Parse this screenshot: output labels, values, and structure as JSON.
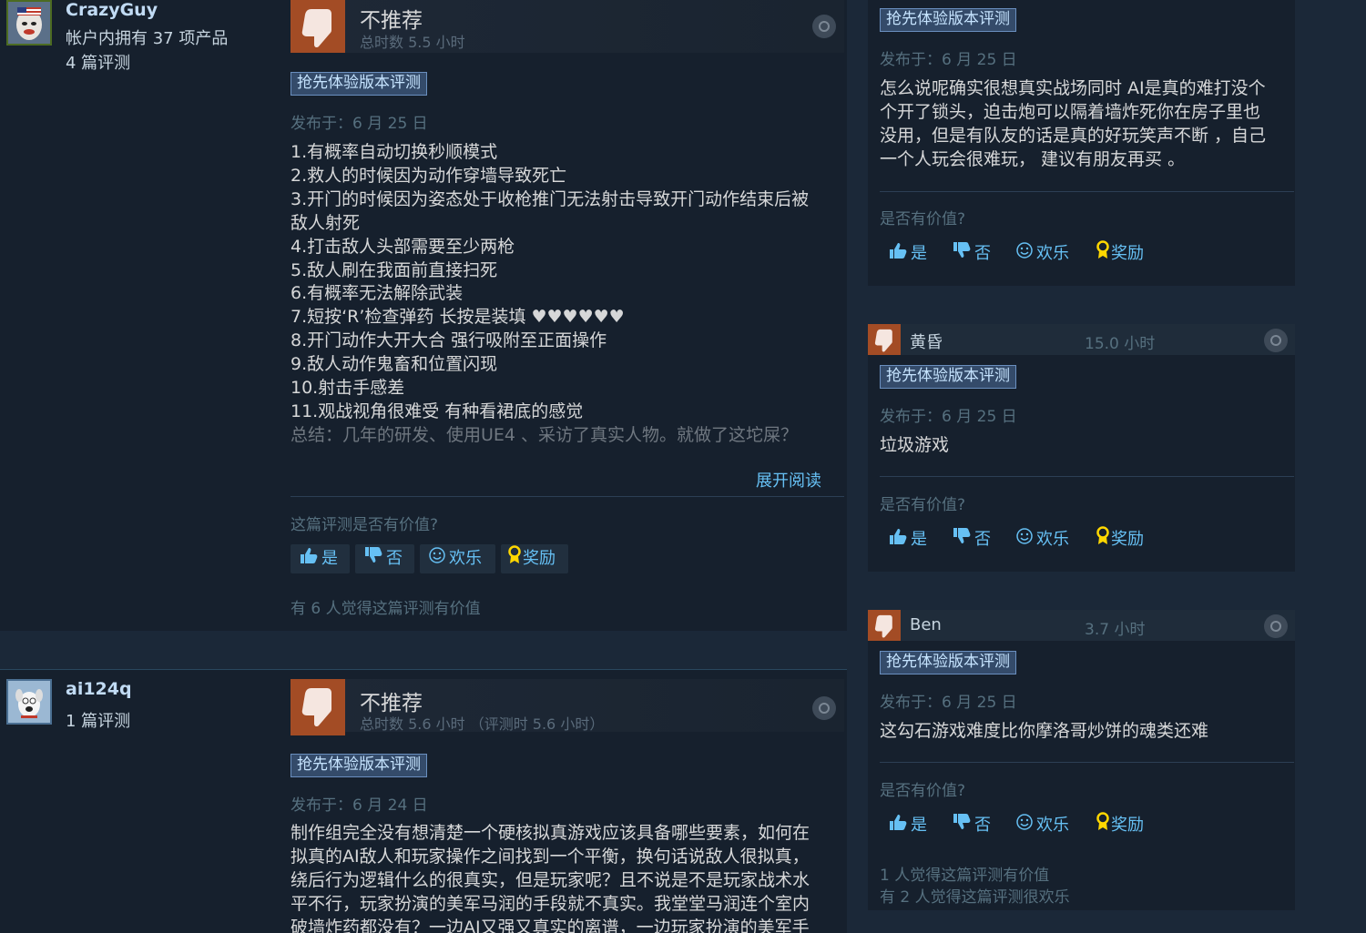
{
  "colors": {
    "accent": "#66c0f4",
    "thumb_down_bg": "#a34c25",
    "early_access_badge": "#344b6a"
  },
  "reviews_left": [
    {
      "author": {
        "name": "CrazyGuy",
        "products": "帐户内拥有 37 项产品",
        "reviews": "4 篇评测"
      },
      "vote": "不推荐",
      "hours": "总时数 5.5 小时",
      "badge": "抢先体验版本评测",
      "posted": "发布于：6 月 25 日",
      "lines": [
        "1.有概率自动切换秒顺模式",
        "2.救人的时候因为动作穿墙导致死亡",
        "3.开门的时候因为姿态处于收枪推门无法射击导致开门动作结束后被",
        "敌人射死",
        "4.打击敌人头部需要至少两枪",
        "5.敌人刷在我面前直接扫死",
        "6.有概率无法解除武装",
        "7.短按‘R’检查弹药 长按是装填 ♥♥♥♥♥♥",
        "8.开门动作大开大合 强行吸附至正面操作",
        "9.敌人动作鬼畜和位置闪现",
        "10.射击手感差",
        "11.观战视角很难受 有种看裙底的感觉",
        "总结：几年的研发、使用UE4 、采访了真实人物。就做了这坨屎？"
      ],
      "read_more": "展开阅读",
      "helpful_q": "这篇评测是否有价值?",
      "buttons": {
        "yes": "是",
        "no": "否",
        "funny": "欢乐",
        "award": "奖励"
      },
      "found_helpful": "有 6 人觉得这篇评测有价值"
    },
    {
      "author": {
        "name": "ai124q",
        "reviews": "1 篇评测"
      },
      "vote": "不推荐",
      "hours": "总时数 5.6 小时 （评测时 5.6 小时）",
      "badge": "抢先体验版本评测",
      "posted": "发布于：6 月 24 日",
      "lines": [
        "制作组完全没有想清楚一个硬核拟真游戏应该具备哪些要素，如何在",
        "拟真的AI敌人和玩家操作之间找到一个平衡，换句话说敌人很拟真，",
        "绕后行为逻辑什么的很真实，但是玩家呢？且不说是不是玩家战术水",
        "平不行，玩家扮演的美军马润的手段就不真实。我堂堂马润连个室内",
        "破墙炸药都没有？一边AI又强又真实的离谱，一边玩家扮演的美军手"
      ]
    }
  ],
  "reviews_right": [
    {
      "badge": "抢先体验版本评测",
      "posted": "发布于：6 月 25 日",
      "lines": [
        "怎么说呢确实很想真实战场同时 AI是真的难打没个",
        "个开了锁头，迫击炮可以隔着墙炸死你在房子里也",
        "没用，但是有队友的话是真的好玩笑声不断 ，自己",
        "一个人玩会很难玩， 建议有朋友再买 。"
      ],
      "helpful_q": "是否有价值?",
      "buttons": {
        "yes": "是",
        "no": "否",
        "funny": "欢乐",
        "award": "奖励"
      }
    },
    {
      "name": "黄昏",
      "hours": "15.0 小时",
      "badge": "抢先体验版本评测",
      "posted": "发布于：6 月 25 日",
      "lines": [
        "垃圾游戏"
      ],
      "helpful_q": "是否有价值?",
      "buttons": {
        "yes": "是",
        "no": "否",
        "funny": "欢乐",
        "award": "奖励"
      }
    },
    {
      "name": "Ben",
      "hours": "3.7 小时",
      "badge": "抢先体验版本评测",
      "posted": "发布于：6 月 25 日",
      "lines": [
        "这勾石游戏难度比你摩洛哥炒饼的魂类还难"
      ],
      "helpful_q": "是否有价值?",
      "buttons": {
        "yes": "是",
        "no": "否",
        "funny": "欢乐",
        "award": "奖励"
      },
      "found_helpful": "1 人觉得这篇评测有价值",
      "found_funny": "有 2 人觉得这篇评测很欢乐"
    }
  ]
}
